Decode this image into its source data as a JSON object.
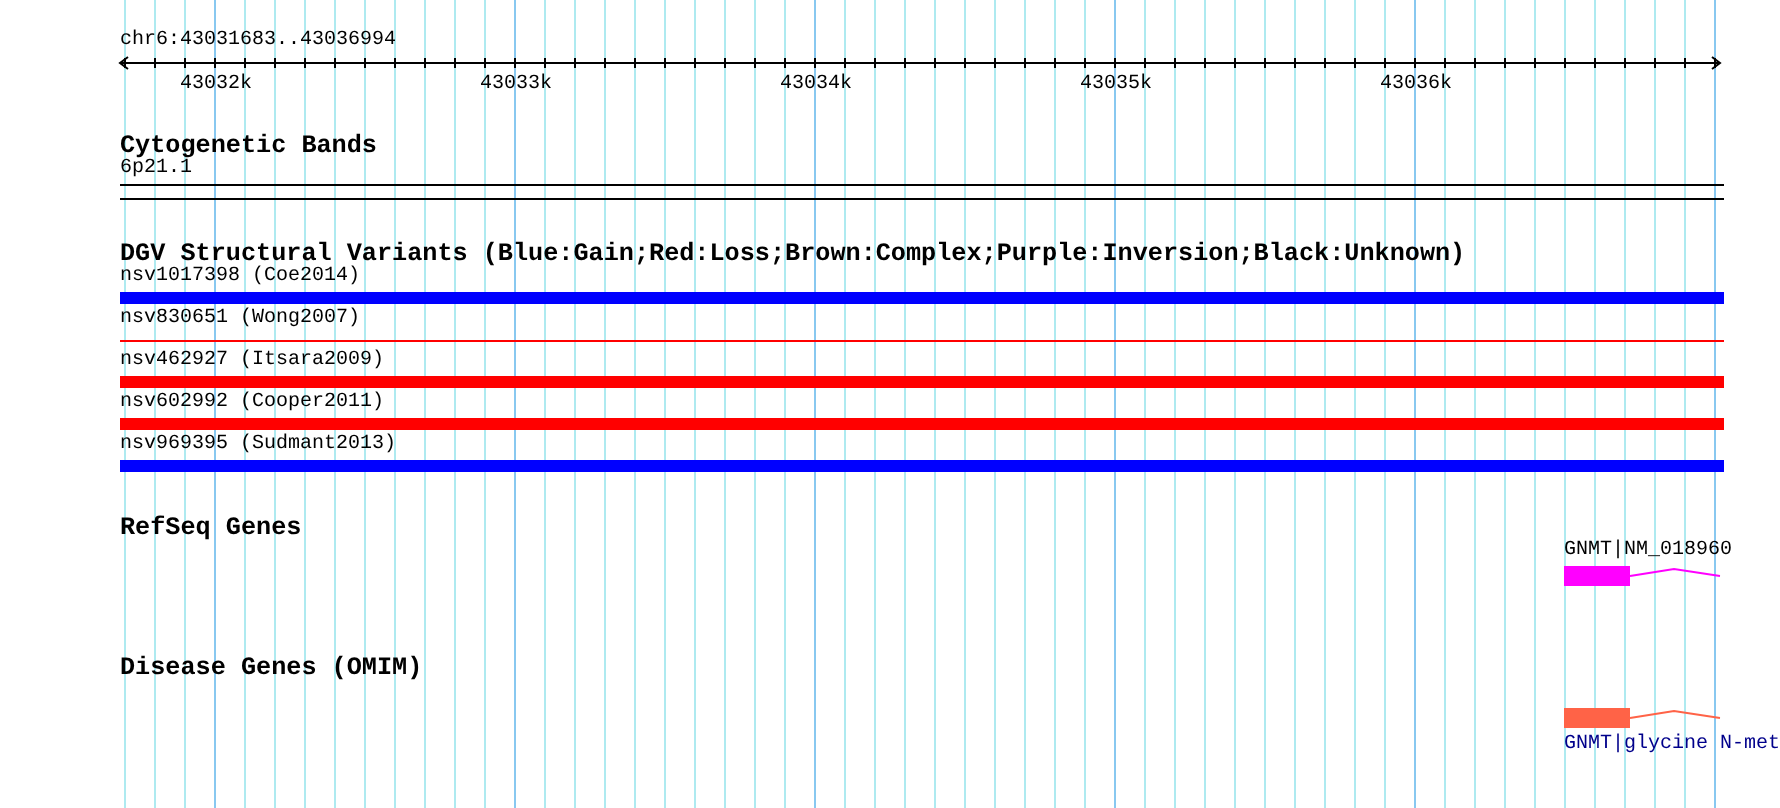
{
  "ruler": {
    "range": "chr6:43031683..43036994",
    "ticks": [
      "43032k",
      "43033k",
      "43034k",
      "43035k",
      "43036k"
    ]
  },
  "cytogenetic_bands": {
    "title": "Cytogenetic Bands",
    "band": "6p21.1"
  },
  "dgv_variants": {
    "title": "DGV Structural Variants (Blue:Gain;Red:Loss;Brown:Complex;Purple:Inversion;Black:Unknown)",
    "items": [
      {
        "label": "nsv1017398 (Coe2014)",
        "kind": "bar",
        "color": "#0000ff"
      },
      {
        "label": "nsv830651 (Wong2007)",
        "kind": "line",
        "color": "#ff0000"
      },
      {
        "label": "nsv462927 (Itsara2009)",
        "kind": "bar",
        "color": "#ff0000"
      },
      {
        "label": "nsv602992 (Cooper2011)",
        "kind": "bar",
        "color": "#ff0000"
      },
      {
        "label": "nsv969395 (Sudmant2013)",
        "kind": "bar",
        "color": "#0000ff"
      }
    ]
  },
  "refseq_genes": {
    "title": "RefSeq Genes",
    "gene": "GNMT|NM_018960"
  },
  "disease_genes": {
    "title": "Disease Genes (OMIM)",
    "gene": "GNMT|glycine N-met"
  }
}
